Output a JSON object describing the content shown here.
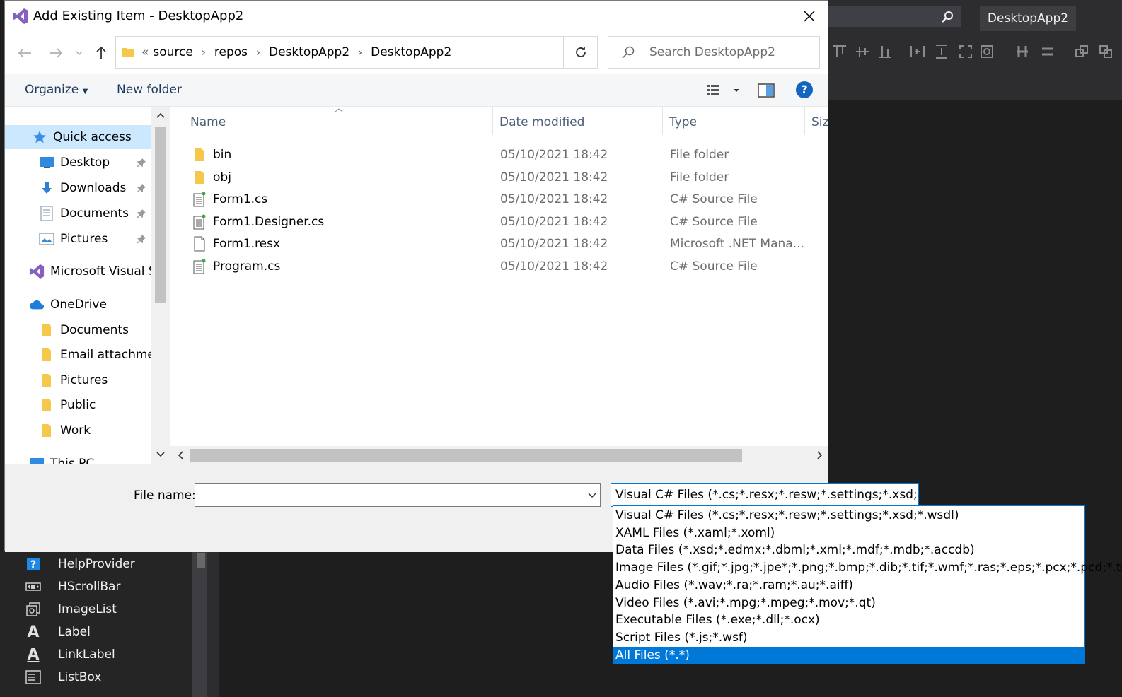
{
  "vs": {
    "solution_name": "DesktopApp2",
    "toolbox_items": [
      {
        "label": "HelpProvider",
        "icon": "help-icon"
      },
      {
        "label": "HScrollBar",
        "icon": "hscrollbar-icon"
      },
      {
        "label": "ImageList",
        "icon": "imagelist-icon"
      },
      {
        "label": "Label",
        "icon": "label-icon"
      },
      {
        "label": "LinkLabel",
        "icon": "linklabel-icon"
      },
      {
        "label": "ListBox",
        "icon": "listbox-icon"
      }
    ]
  },
  "dialog": {
    "title": "Add Existing Item - DesktopApp2",
    "breadcrumb": [
      "«",
      "source",
      "repos",
      "DesktopApp2",
      "DesktopApp2"
    ],
    "search_placeholder": "Search DesktopApp2",
    "toolbar": {
      "organize": "Organize",
      "new_folder": "New folder"
    },
    "nav": {
      "quick_access": "Quick access",
      "quick_items": [
        {
          "label": "Desktop",
          "icon": "desktop-icon"
        },
        {
          "label": "Downloads",
          "icon": "downloads-icon"
        },
        {
          "label": "Documents",
          "icon": "documents-icon"
        },
        {
          "label": "Pictures",
          "icon": "pictures-icon"
        }
      ],
      "visual_studio": "Microsoft Visual S",
      "onedrive": "OneDrive",
      "onedrive_items": [
        "Documents",
        "Email attachmen",
        "Pictures",
        "Public",
        "Work"
      ],
      "this_pc": "This PC"
    },
    "columns": {
      "name": "Name",
      "date": "Date modified",
      "type": "Type",
      "size": "Size"
    },
    "files": [
      {
        "name": "bin",
        "date": "05/10/2021 18:42",
        "type": "File folder",
        "icon": "folder-icon"
      },
      {
        "name": "obj",
        "date": "05/10/2021 18:42",
        "type": "File folder",
        "icon": "folder-icon"
      },
      {
        "name": "Form1.cs",
        "date": "05/10/2021 18:42",
        "type": "C# Source File",
        "icon": "csharp-file-icon"
      },
      {
        "name": "Form1.Designer.cs",
        "date": "05/10/2021 18:42",
        "type": "C# Source File",
        "icon": "csharp-file-icon"
      },
      {
        "name": "Form1.resx",
        "date": "05/10/2021 18:42",
        "type": "Microsoft .NET Mana...",
        "icon": "file-icon"
      },
      {
        "name": "Program.cs",
        "date": "05/10/2021 18:42",
        "type": "C# Source File",
        "icon": "csharp-file-icon"
      }
    ],
    "file_name_label": "File name:",
    "file_name_value": "",
    "file_type_selected": "Visual C# Files (*.cs;*.resx;*.resw;*.settings;*.xsd;*.wsdl)",
    "file_type_options": [
      "Visual C# Files (*.cs;*.resx;*.resw;*.settings;*.xsd;*.wsdl)",
      "XAML Files (*.xaml;*.xoml)",
      "Data Files (*.xsd;*.edmx;*.dbml;*.xml;*.mdf;*.mdb;*.accdb)",
      "Image Files (*.gif;*.jpg;*.jpe*;*.png;*.bmp;*.dib;*.tif;*.wmf;*.ras;*.eps;*.pcx;*.pcd;*.tga)",
      "Audio Files (*.wav;*.ra;*.ram;*.au;*.aiff)",
      "Video Files (*.avi;*.mpg;*.mpeg;*.mov;*.qt)",
      "Executable Files (*.exe;*.dll;*.ocx)",
      "Script Files (*.js;*.wsf)",
      "All Files (*.*)"
    ],
    "highlighted_option": "All Files (*.*)"
  }
}
